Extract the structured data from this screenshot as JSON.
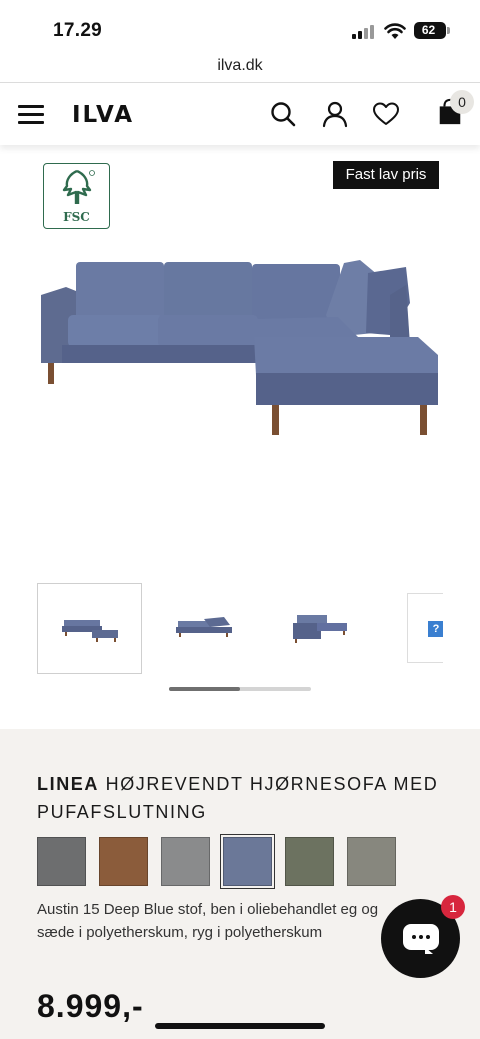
{
  "status_bar": {
    "time": "17.29",
    "battery": "62",
    "battery_level": 0.62
  },
  "browser": {
    "url": "ilva.dk"
  },
  "header": {
    "logo": "ILVA",
    "cart_count": "0"
  },
  "gallery": {
    "badge": "Fast lav pris",
    "certification_logo": "FSC",
    "thumbnails": [
      "sofa-front",
      "sofa-top",
      "sofa-side",
      "missing-image"
    ],
    "active_thumbnail": 0,
    "scroll_position": 0.5
  },
  "product": {
    "brand": "LINEA",
    "name": " HØJREVENDT HJØRNESOFA MED PUFAFSLUTNING",
    "colors": [
      "#6d6e6f",
      "#8b5c3b",
      "#8a8b8c",
      "#6b7898",
      "#6c7260",
      "#87877e"
    ],
    "selected_color": 3,
    "description": "Austin 15 Deep Blue stof, ben i oliebehandlet eg og sæde i polyetherskum, ryg i polyetherskum",
    "price": "8.999,-"
  },
  "chat": {
    "unread": "1"
  }
}
